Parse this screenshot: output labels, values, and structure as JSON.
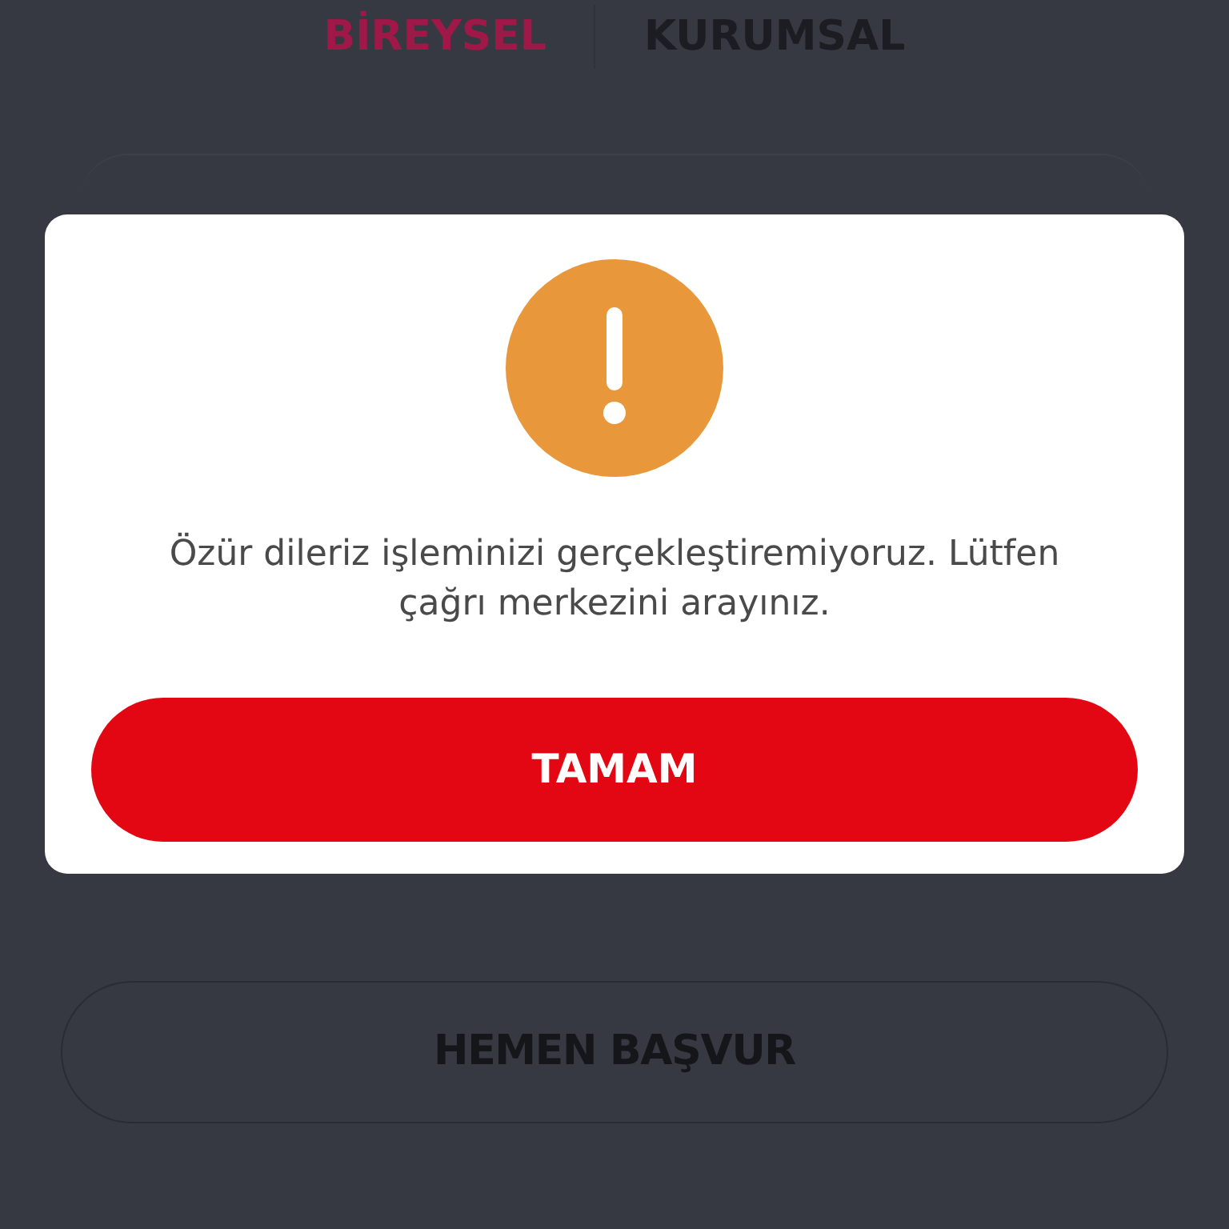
{
  "tabs": [
    {
      "label": "BİREYSEL",
      "selected": true
    },
    {
      "label": "KURUMSAL",
      "selected": false
    }
  ],
  "apply_button": "HEMEN BAŞVUR",
  "dialog": {
    "message": "Özür dileriz işleminizi gerçekleştiremiyoruz. Lütfen çağrı merkezini arayınız.",
    "button": "TAMAM"
  }
}
